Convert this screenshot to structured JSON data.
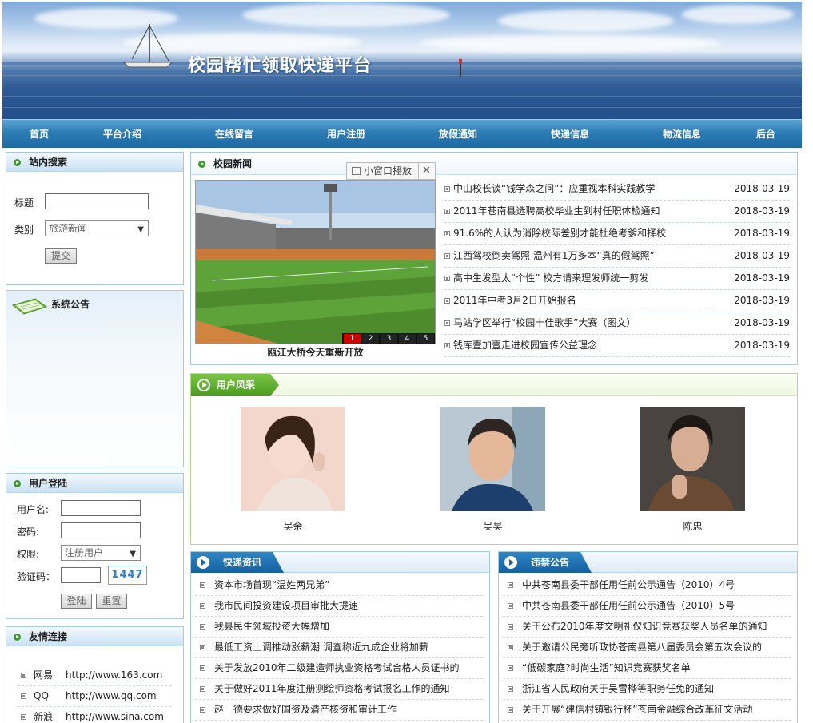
{
  "site": {
    "title": "校园帮忙领取快递平台"
  },
  "nav": {
    "items": [
      "首页",
      "平台介绍",
      "在线留言",
      "用户注册",
      "放假通知",
      "快递信息",
      "物流信息",
      "后台"
    ]
  },
  "search": {
    "title": "站内搜索",
    "title_label": "标题",
    "category_label": "类别",
    "category_value": "旅游新闻",
    "submit_label": "提交"
  },
  "notice": {
    "title": "系统公告"
  },
  "login": {
    "title": "用户登陆",
    "username_label": "用户名:",
    "password_label": "密码:",
    "role_label": "权限:",
    "role_value": "注册用户",
    "captcha_label": "验证码：",
    "captcha_code": "1447",
    "login_label": "登陆",
    "reset_label": "重置"
  },
  "links": {
    "title": "友情连接",
    "items": [
      {
        "name": "网易",
        "url": "http://www.163.com"
      },
      {
        "name": "QQ",
        "url": "http://www.qq.com"
      },
      {
        "name": "新浪",
        "url": "http://www.sina.com"
      }
    ]
  },
  "campus_news": {
    "title": "校园新闻",
    "popup_label": "小窗口播放",
    "slide_caption": "瓯江大桥今天重新开放",
    "slide_pages": [
      "1",
      "2",
      "3",
      "4",
      "5"
    ],
    "active_page": "1",
    "items": [
      {
        "title": "中山校长谈“钱学森之问”：应重视本科实践教学",
        "date": "2018-03-19"
      },
      {
        "title": "2011年苍南县选聘高校毕业生到村任职体检通知",
        "date": "2018-03-19"
      },
      {
        "title": "91.6%的人认为消除校际差别才能杜绝考爹和择校",
        "date": "2018-03-19"
      },
      {
        "title": "江西驾校倒卖驾照 温州有1万多本“真的假驾照”",
        "date": "2018-03-19"
      },
      {
        "title": "高中生发型太“个性” 校方请来理发师统一剪发",
        "date": "2018-03-19"
      },
      {
        "title": "2011年中考3月2日开始报名",
        "date": "2018-03-19"
      },
      {
        "title": "马站学区举行“校园十佳歌手”大赛（图文）",
        "date": "2018-03-19"
      },
      {
        "title": "钱库壹加壹走进校园宣传公益理念",
        "date": "2018-03-19"
      }
    ]
  },
  "users": {
    "title": "用户风采",
    "items": [
      {
        "name": "吴余"
      },
      {
        "name": "吴昊"
      },
      {
        "name": "陈忠"
      }
    ]
  },
  "express": {
    "title": "快递资讯",
    "items": [
      "资本市场首现“温姓两兄弟”",
      "我市民间投资建设项目审批大提速",
      "我县民生领域投资大幅增加",
      "最低工资上调推动涨薪潮 调查称近九成企业将加薪",
      "关于发放2010年二级建造师执业资格考试合格人员证书的",
      "关于做好2011年度注册测绘师资格考试报名工作的通知",
      "赵一德要求做好国资及清产核资和审计工作"
    ]
  },
  "violation": {
    "title": "违禁公告",
    "items": [
      "中共苍南县委干部任用任前公示通告（2010）4号",
      "中共苍南县委干部任用任前公示通告（2010）5号",
      "关于公布2010年度文明礼仪知识竞赛获奖人员名单的通知",
      "关于邀请公民旁听政协苍南县第八届委员会第五次会议的",
      "“低碳家庭?时尚生活”知识竞赛获奖名单",
      "浙江省人民政府关于吴雪桦等职务任免的通知",
      "关于开展“建信村镇银行杯”苍南金融综合改革征文活动"
    ]
  },
  "colors": {
    "nav": "#2d7cb5",
    "accent_green": "#4a9c1e",
    "panel_border": "#a5cbe3"
  }
}
